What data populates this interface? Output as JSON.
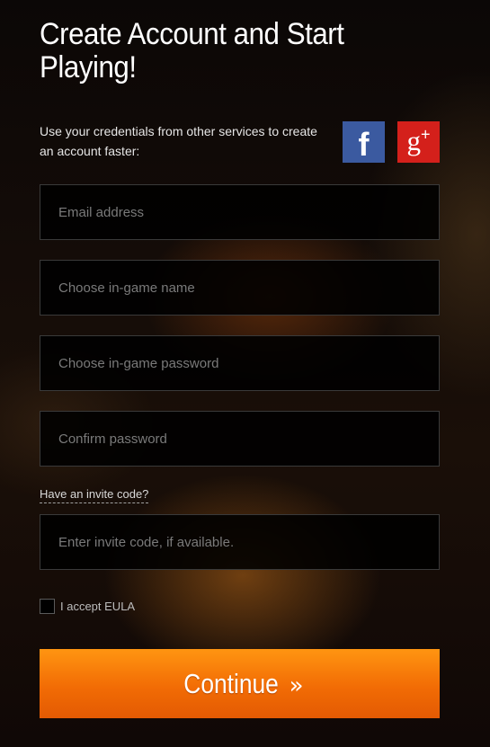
{
  "header": {
    "title": "Create Account and Start Playing!"
  },
  "social": {
    "text": "Use your credentials from other services to create an account faster:",
    "facebook_glyph": "f",
    "google_glyph": "g",
    "google_plus": "+",
    "facebook_color": "#3b5aa0",
    "google_color": "#d4201b"
  },
  "form": {
    "email_placeholder": "Email address",
    "name_placeholder": "Choose in-game name",
    "password_placeholder": "Choose in-game password",
    "confirm_placeholder": "Confirm password",
    "invite_link": "Have an invite code?",
    "invite_placeholder": "Enter invite code, if available.",
    "eula_label": "I accept EULA",
    "continue_label": "Continue",
    "continue_chevrons": "»",
    "accent_color": "#f7790a"
  }
}
